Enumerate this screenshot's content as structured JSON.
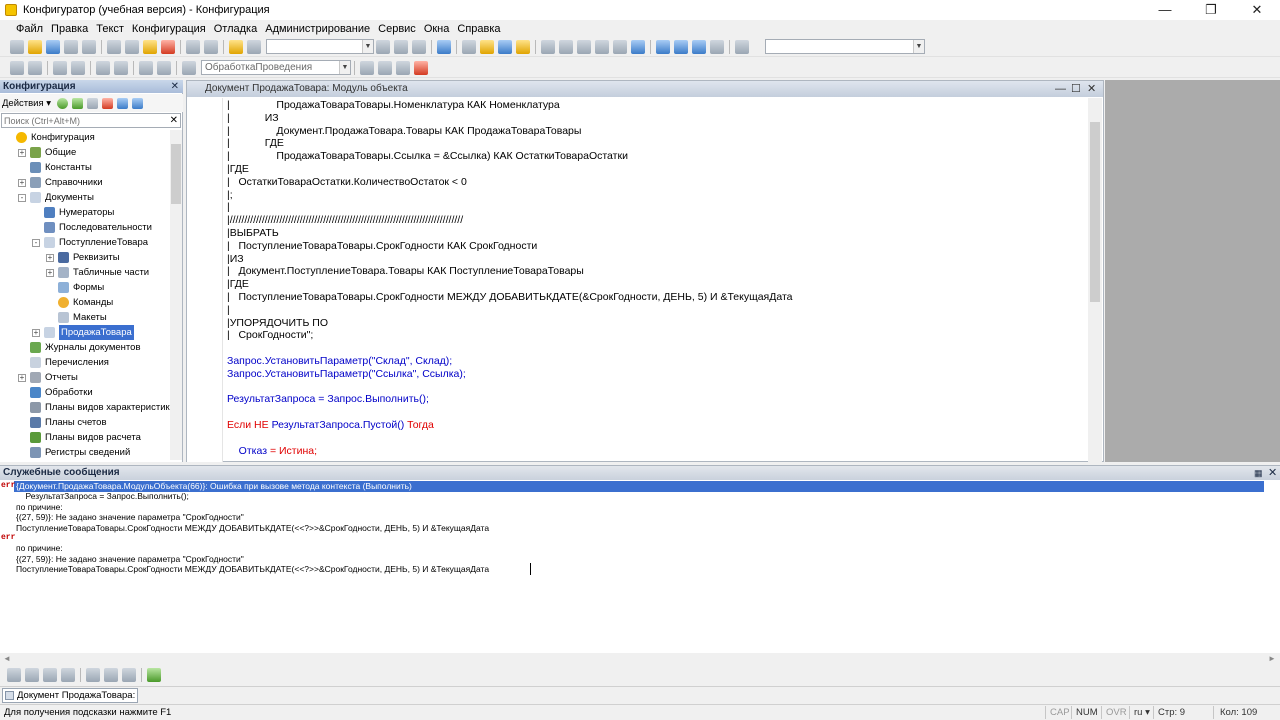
{
  "window": {
    "title": "Конфигуратор (учебная версия) - Конфигурация",
    "minimize": "—",
    "restore": "❐",
    "close": "✕"
  },
  "menu": [
    "Файл",
    "Правка",
    "Текст",
    "Конфигурация",
    "Отладка",
    "Администрирование",
    "Сервис",
    "Окна",
    "Справка"
  ],
  "toolbar2": {
    "procedure_combo": "ОбработкаПроведения"
  },
  "config_panel": {
    "title": "Конфигурация",
    "close": "✕",
    "actions_label": "Действия ▾",
    "search_placeholder": "Поиск (Ctrl+Alt+M)",
    "search_clear": "✕",
    "tree": [
      {
        "label": "Конфигурация",
        "level": 0,
        "exp": "none",
        "icon": "config"
      },
      {
        "label": "Общие",
        "level": 1,
        "exp": "+",
        "icon": "common"
      },
      {
        "label": "Константы",
        "level": 1,
        "exp": "none",
        "icon": "const"
      },
      {
        "label": "Справочники",
        "level": 1,
        "exp": "+",
        "icon": "catalog"
      },
      {
        "label": "Документы",
        "level": 1,
        "exp": "-",
        "icon": "doc"
      },
      {
        "label": "Нумераторы",
        "level": 2,
        "exp": "none",
        "icon": "num"
      },
      {
        "label": "Последовательности",
        "level": 2,
        "exp": "none",
        "icon": "seq"
      },
      {
        "label": "ПоступлениеТовара",
        "level": 2,
        "exp": "-",
        "icon": "doc"
      },
      {
        "label": "Реквизиты",
        "level": 3,
        "exp": "+",
        "icon": "attr"
      },
      {
        "label": "Табличные части",
        "level": 3,
        "exp": "+",
        "icon": "table"
      },
      {
        "label": "Формы",
        "level": 3,
        "exp": "none",
        "icon": "form"
      },
      {
        "label": "Команды",
        "level": 3,
        "exp": "none",
        "icon": "cmd"
      },
      {
        "label": "Макеты",
        "level": 3,
        "exp": "none",
        "icon": "tmpl"
      },
      {
        "label": "ПродажаТовара",
        "level": 2,
        "exp": "+",
        "icon": "doc",
        "selected": true
      },
      {
        "label": "Журналы документов",
        "level": 1,
        "exp": "none",
        "icon": "journal"
      },
      {
        "label": "Перечисления",
        "level": 1,
        "exp": "none",
        "icon": "enum"
      },
      {
        "label": "Отчеты",
        "level": 1,
        "exp": "+",
        "icon": "report"
      },
      {
        "label": "Обработки",
        "level": 1,
        "exp": "none",
        "icon": "proc"
      },
      {
        "label": "Планы видов характеристик",
        "level": 1,
        "exp": "none",
        "icon": "pvh"
      },
      {
        "label": "Планы счетов",
        "level": 1,
        "exp": "none",
        "icon": "accounts"
      },
      {
        "label": "Планы видов расчета",
        "level": 1,
        "exp": "none",
        "icon": "calc"
      },
      {
        "label": "Регистры сведений",
        "level": 1,
        "exp": "none",
        "icon": "reg"
      }
    ]
  },
  "editor": {
    "title": "Документ ПродажаТовара: Модуль объекта",
    "ctl_min": "—",
    "ctl_max": "☐",
    "ctl_close": "✕",
    "lines": [
      {
        "t": "|                ПродажаТовараТовары.Номенклатура КАК Номенклатура",
        "c": "tx"
      },
      {
        "t": "|            ИЗ",
        "c": "tx"
      },
      {
        "t": "|                Документ.ПродажаТовара.Товары КАК ПродажаТовараТовары",
        "c": "tx"
      },
      {
        "t": "|            ГДЕ",
        "c": "tx"
      },
      {
        "t": "|                ПродажаТовараТовары.Ссылка = &Ссылка) КАК ОстаткиТовараОстатки",
        "c": "tx"
      },
      {
        "t": "|ГДЕ",
        "c": "tx"
      },
      {
        "t": "|   ОстаткиТовараОстатки.КоличествоОстаток < 0",
        "c": "tx"
      },
      {
        "t": "|;",
        "c": "tx"
      },
      {
        "t": "|",
        "c": "tx"
      },
      {
        "t": "|////////////////////////////////////////////////////////////////////////////////",
        "c": "tx"
      },
      {
        "t": "|ВЫБРАТЬ",
        "c": "tx"
      },
      {
        "t": "|   ПоступлениеТовараТовары.СрокГодности КАК СрокГодности",
        "c": "tx"
      },
      {
        "t": "|ИЗ",
        "c": "tx"
      },
      {
        "t": "|   Документ.ПоступлениеТовара.Товары КАК ПоступлениеТовараТовары",
        "c": "tx"
      },
      {
        "t": "|ГДЕ",
        "c": "tx"
      },
      {
        "t": "|   ПоступлениеТовараТовары.СрокГодности МЕЖДУ ДОБАВИТЬКДАТЕ(&СрокГодности, ДЕНЬ, 5) И &ТекущаяДата",
        "c": "tx"
      },
      {
        "t": "|",
        "c": "tx"
      },
      {
        "t": "|УПОРЯДОЧИТЬ ПО",
        "c": "tx"
      },
      {
        "t": "|   СрокГодности\";",
        "c": "tx"
      },
      {
        "t": "",
        "c": "tx"
      },
      {
        "t": "Запрос.УстановитьПараметр(\"Склад\", Склад);",
        "c": "fn"
      },
      {
        "t": "Запрос.УстановитьПараметр(\"Ссылка\", Ссылка);",
        "c": "fn"
      },
      {
        "t": "",
        "c": "tx"
      },
      {
        "t": "РезультатЗапроса = Запрос.Выполнить();",
        "c": "fn"
      },
      {
        "t": "",
        "c": "tx"
      },
      {
        "t": "Если НЕ РезультатЗапроса.Пустой() Тогда",
        "c": "mix"
      },
      {
        "t": "",
        "c": "tx"
      },
      {
        "t": "    Отказ = Истина;",
        "c": "mix2"
      }
    ]
  },
  "messages": {
    "title": "Служебные сообщения",
    "close": "✕",
    "err_tag": "err",
    "lines": [
      {
        "t": "{Документ.ПродажаТовара.МодульОбъекта(66)}: Ошибка при вызове метода контекста (Выполнить)",
        "hl": true
      },
      {
        "t": "    РезультатЗапроса = Запрос.Выполнить();"
      },
      {
        "t": "по причине:"
      },
      {
        "t": "{(27, 59)}: Не задано значение параметра \"СрокГодности\""
      },
      {
        "t": "ПоступлениеТовараТовары.СрокГодности МЕЖДУ ДОБАВИТЬКДАТЕ(<<?>>&СрокГодности, ДЕНЬ, 5) И &ТекущаяДата"
      },
      {
        "t": ""
      },
      {
        "t": "по причине:"
      },
      {
        "t": "{(27, 59)}: Не задано значение параметра \"СрокГодности\""
      },
      {
        "t": "ПоступлениеТовараТовары.СрокГодности МЕЖДУ ДОБАВИТЬКДАТЕ(<<?>>&СрокГодности, ДЕНЬ, 5) И &ТекущаяДата"
      }
    ],
    "scroll_left": "◄",
    "scroll_right": "►"
  },
  "taskbar": {
    "doc_tab": "Документ ПродажаТовара: ..."
  },
  "status": {
    "hint": "Для получения подсказки нажмите F1",
    "cap": "CAP",
    "num": "NUM",
    "ovr": "OVR",
    "lang": "ru ▾",
    "row": "Стр: 9",
    "col": "Кол: 109"
  },
  "colors": {
    "keyword": "#e00000",
    "function": "#0000c8",
    "selection": "#3b6fcf"
  }
}
